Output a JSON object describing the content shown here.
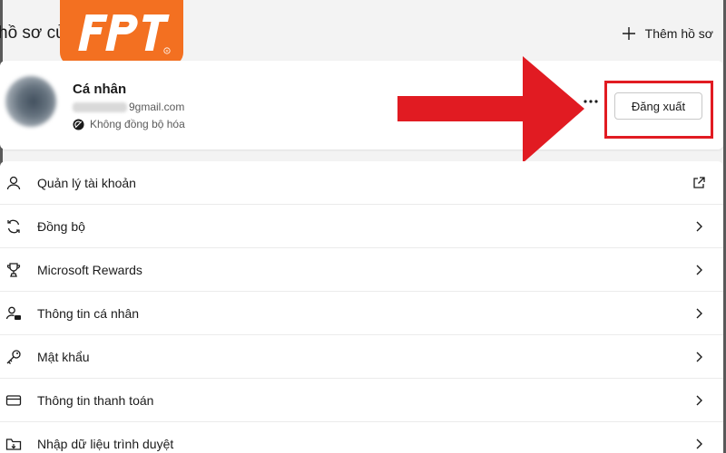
{
  "header": {
    "title": "hồ sơ củ",
    "add_profile_label": "Thêm hồ sơ"
  },
  "logo": {
    "text": "FPT",
    "brand_color": "#f37021"
  },
  "profile": {
    "name": "Cá nhân",
    "email_suffix": "9gmail.com",
    "sync_status": "Không đồng bộ hóa",
    "more_icon": "more-horizontal-icon",
    "signout_label": "Đăng xuất"
  },
  "annotation": {
    "color": "#e11b22"
  },
  "menu": {
    "items": [
      {
        "label": "Quản lý tài khoản",
        "icon": "person-icon",
        "trailing": "external-link-icon"
      },
      {
        "label": "Đồng bộ",
        "icon": "sync-icon",
        "trailing": "chevron-right-icon"
      },
      {
        "label": "Microsoft Rewards",
        "icon": "trophy-icon",
        "trailing": "chevron-right-icon"
      },
      {
        "label": "Thông tin cá nhân",
        "icon": "person-card-icon",
        "trailing": "chevron-right-icon"
      },
      {
        "label": "Mật khẩu",
        "icon": "key-icon",
        "trailing": "chevron-right-icon"
      },
      {
        "label": "Thông tin thanh toán",
        "icon": "credit-card-icon",
        "trailing": "chevron-right-icon"
      },
      {
        "label": "Nhập dữ liệu trình duyệt",
        "icon": "import-folder-icon",
        "trailing": "chevron-right-icon"
      }
    ]
  }
}
